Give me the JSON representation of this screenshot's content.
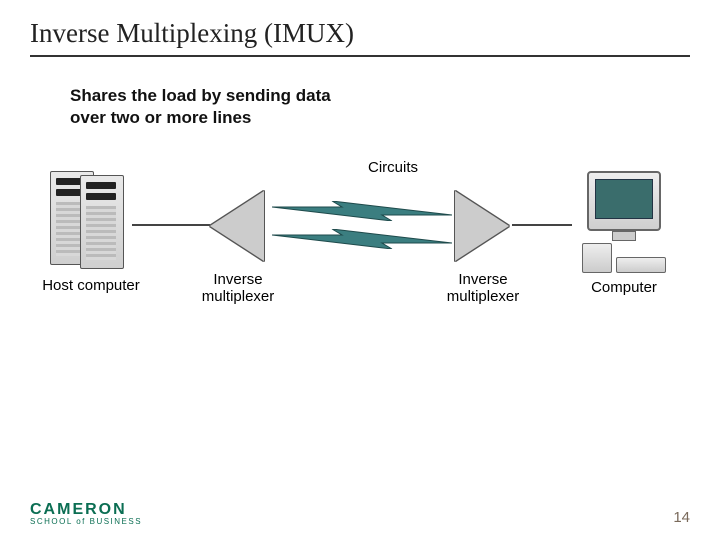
{
  "slide": {
    "title": "Inverse Multiplexing (IMUX)",
    "body_text": "Shares the load by sending data over two or more lines"
  },
  "diagram": {
    "circuits_label": "Circuits",
    "nodes": {
      "host": "Host computer",
      "mux_left": "Inverse\nmultiplexer",
      "mux_right": "Inverse\nmultiplexer",
      "computer": "Computer"
    }
  },
  "footer": {
    "logo_line1": "CAMERON",
    "logo_line2": "SCHOOL of BUSINESS",
    "page_number": "14"
  }
}
